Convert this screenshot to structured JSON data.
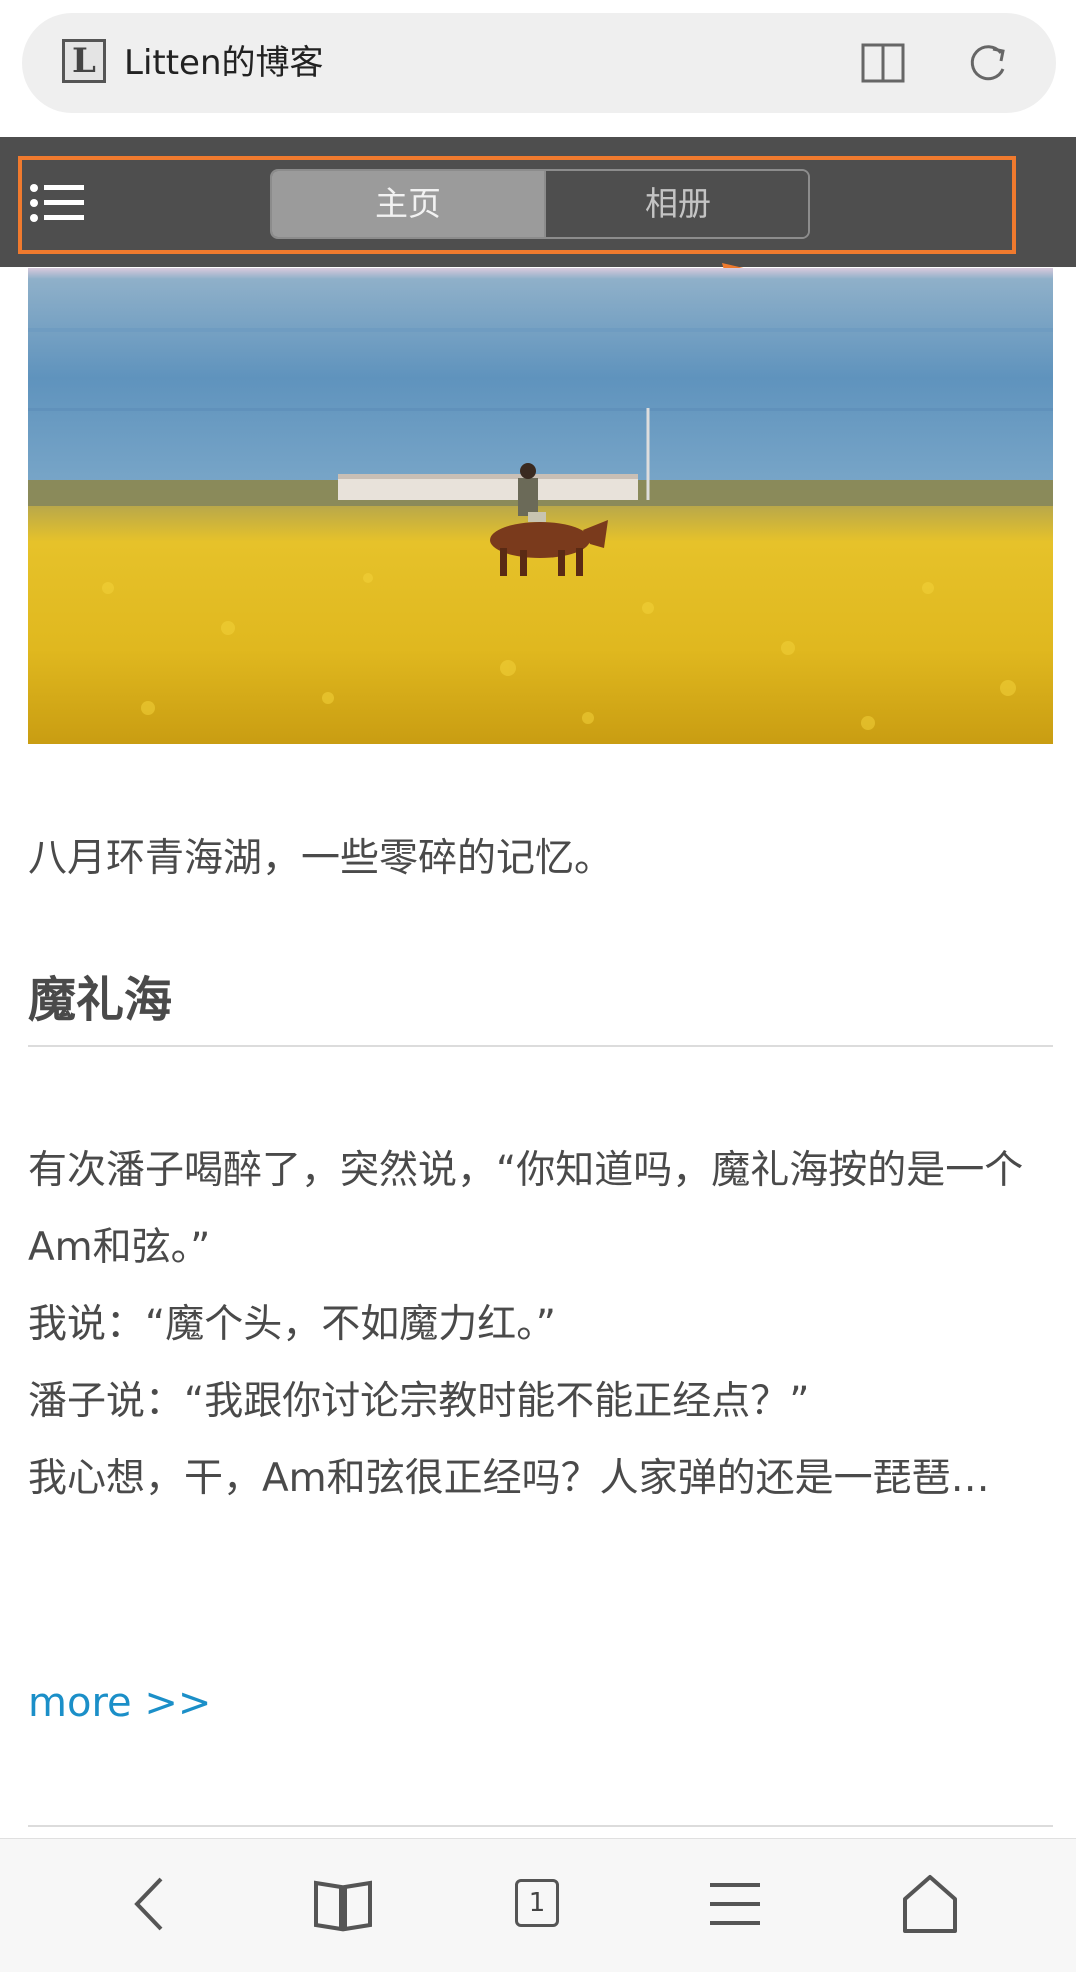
{
  "browser": {
    "site_icon_letter": "L",
    "page_title": "Litten的博客",
    "reader_icon": "book-open-icon",
    "reload_icon": "reload-icon"
  },
  "nav": {
    "menu_icon": "list-menu-icon",
    "tabs": [
      {
        "label": "主页",
        "selected": true
      },
      {
        "label": "相册",
        "selected": false
      }
    ],
    "annotation_color": "#f07a2e"
  },
  "article": {
    "intro": "八月环青海湖，一些零碎的记忆。",
    "heading": "魔礼海",
    "paragraph_lines": [
      "有次潘子喝醉了，突然说，“你知道吗，魔礼海按的是一个Am和弦。”",
      "我说：“魔个头，不如魔力红。”",
      "潘子说：“我跟你讨论宗教时能不能正经点？”",
      "我心想，干，Am和弦很正经吗？人家弹的还是一琵琶…"
    ],
    "more_link": "more >>",
    "link_color": "#1b8fc8"
  },
  "toolbar": {
    "tab_count": "1",
    "icons": [
      "back-icon",
      "bookmarks-icon",
      "tabs-icon",
      "menu-icon",
      "home-icon"
    ]
  }
}
